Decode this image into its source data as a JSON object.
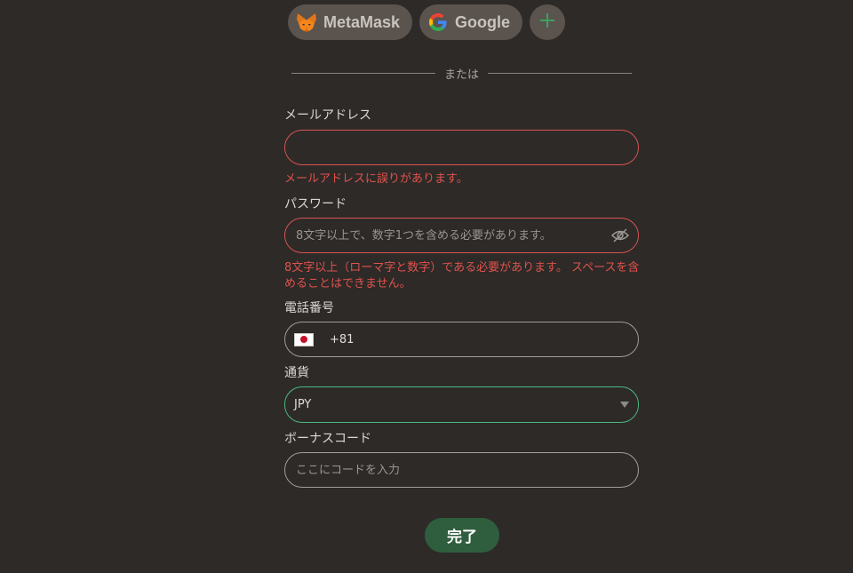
{
  "social": {
    "metamask_label": "MetaMask",
    "google_label": "Google",
    "more_icon": "plus-icon"
  },
  "divider": {
    "text": "または"
  },
  "email": {
    "label": "メールアドレス",
    "value": "",
    "placeholder": "",
    "error": "メールアドレスに誤りがあります。"
  },
  "password": {
    "label": "パスワード",
    "value": "",
    "placeholder": "8文字以上で、数字1つを含める必要があります。",
    "error": "8文字以上（ローマ字と数字）である必要があります。 スペースを含めることはできません。",
    "toggle_icon": "eye-slash-icon"
  },
  "phone": {
    "label": "電話番号",
    "country_flag": "japan-flag-icon",
    "code": "+81",
    "value": ""
  },
  "currency": {
    "label": "通貨",
    "selected": "JPY"
  },
  "bonus": {
    "label": "ボーナスコード",
    "value": "",
    "placeholder": "ここにコードを入力"
  },
  "submit": {
    "label": "完了"
  },
  "colors": {
    "background": "#2d2a28",
    "error": "#e0524c",
    "focus": "#4bb880",
    "submit": "#2f5e3e",
    "social_button": "#5a534e"
  }
}
